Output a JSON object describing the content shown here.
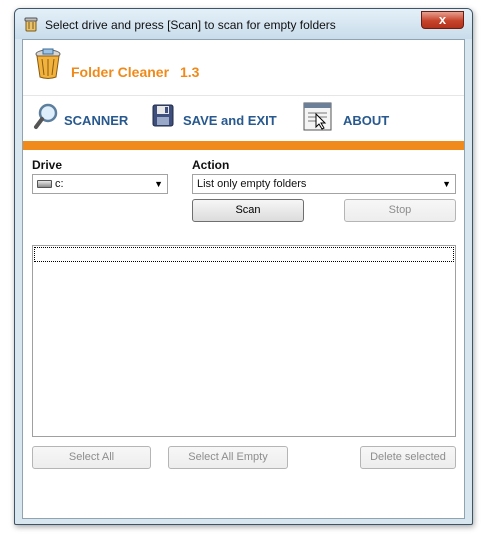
{
  "window": {
    "title": "Select drive and press [Scan] to scan for empty folders",
    "close_label": "x"
  },
  "app": {
    "name": "Folder Cleaner",
    "version": "1.3"
  },
  "toolbar": {
    "scanner_label": "SCANNER",
    "save_exit_label": "SAVE and EXIT",
    "about_label": "ABOUT"
  },
  "drive": {
    "label": "Drive",
    "selected": "c:"
  },
  "action": {
    "label": "Action",
    "selected": "List only empty folders"
  },
  "buttons": {
    "scan": "Scan",
    "stop": "Stop",
    "select_all": "Select All",
    "select_all_empty": "Select All Empty",
    "delete_selected": "Delete selected"
  },
  "colors": {
    "accent_orange": "#f08a1d",
    "toolbar_text": "#27598f"
  }
}
